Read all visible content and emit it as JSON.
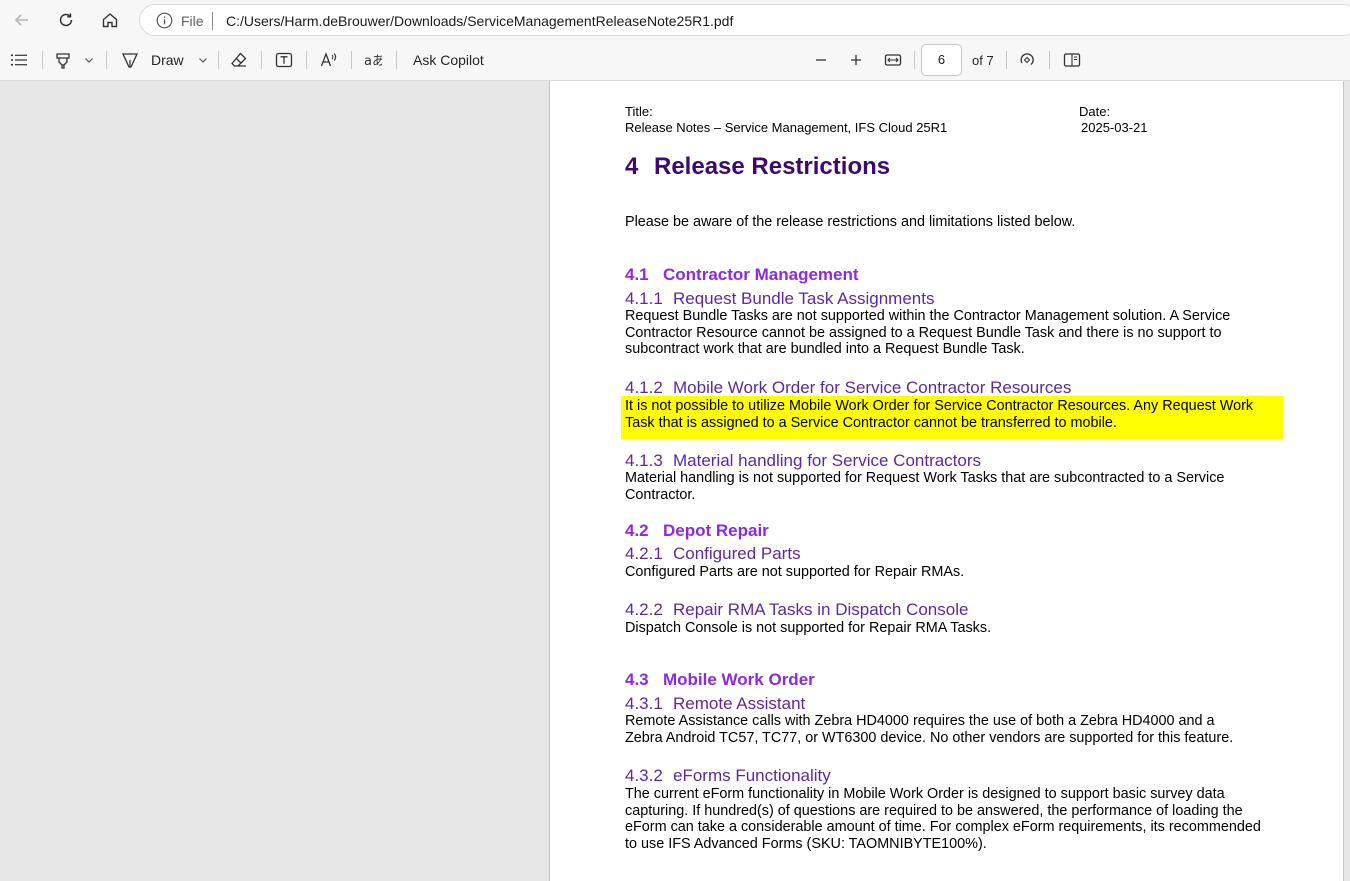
{
  "browser": {
    "file_label": "File",
    "url": "C:/Users/Harm.deBrouwer/Downloads/ServiceManagementReleaseNote25R1.pdf"
  },
  "toolbar": {
    "draw_label": "Draw",
    "copilot_label": "Ask Copilot",
    "page_current": "6",
    "page_of": "of 7"
  },
  "doc": {
    "title_label": "Title:",
    "title_value": "Release Notes – Service Management, IFS Cloud 25R1",
    "date_label": "Date:",
    "date_value": "2025-03-21",
    "h1": {
      "num": "4",
      "text": "Release Restrictions"
    },
    "intro": "Please be aware of the release restrictions and limitations listed below.",
    "s41": {
      "num": "4.1",
      "text": "Contractor Management"
    },
    "s411": {
      "num": "4.1.1",
      "text": "Request Bundle Task Assignments"
    },
    "p411": "Request Bundle Tasks are not supported within the Contractor Management solution. A Service Contractor Resource cannot be assigned to a Request Bundle Task and there is no support to subcontract work that are bundled into a Request Bundle Task.",
    "s412": {
      "num": "4.1.2",
      "text": "Mobile Work Order for Service Contractor Resources"
    },
    "p412": "It is not possible to utilize Mobile Work Order for Service Contractor Resources. Any Request Work Task that is assigned to a Service Contractor cannot be transferred to mobile.",
    "s413": {
      "num": "4.1.3",
      "text": "Material handling for Service Contractors"
    },
    "p413": "Material handling is not supported for Request Work Tasks that are subcontracted to a Service Contractor.",
    "s42": {
      "num": "4.2",
      "text": "Depot Repair"
    },
    "s421": {
      "num": "4.2.1",
      "text": "Configured Parts"
    },
    "p421": "Configured Parts are not supported for Repair RMAs.",
    "s422": {
      "num": "4.2.2",
      "text": "Repair RMA Tasks in Dispatch Console"
    },
    "p422": "Dispatch Console is not supported for Repair RMA Tasks.",
    "s43": {
      "num": "4.3",
      "text": "Mobile Work Order"
    },
    "s431": {
      "num": "4.3.1",
      "text": "Remote Assistant"
    },
    "p431": "Remote Assistance calls with Zebra HD4000 requires the use of both a Zebra HD4000 and a Zebra Android TC57, TC77, or WT6300 device. No other vendors are supported for this feature.",
    "s432": {
      "num": "4.3.2",
      "text": "eForms Functionality"
    },
    "p432": "The current eForm functionality in Mobile Work Order is designed to support basic survey data capturing. If hundred(s) of questions are required to be answered, the performance of loading the eForm can take a considerable amount of time. For complex eForm requirements, its recommended to use IFS Advanced Forms (SKU: TAOMNIBYTE100%)."
  }
}
